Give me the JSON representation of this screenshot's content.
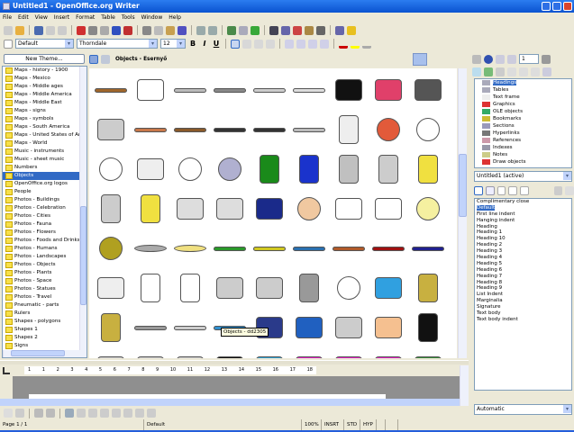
{
  "window": {
    "title": "Untitled1 - OpenOffice.org Writer"
  },
  "menu": [
    "File",
    "Edit",
    "View",
    "Insert",
    "Format",
    "Table",
    "Tools",
    "Window",
    "Help"
  ],
  "format_bar": {
    "style": "Default",
    "font": "Thorndale",
    "size": "12",
    "bold": "B",
    "italic": "I",
    "underline": "U"
  },
  "gallery": {
    "new_theme_label": "New Theme...",
    "themes": [
      "Maps - history - 1900",
      "Maps - Mexico",
      "Maps - Middle ages",
      "Maps - Middle America",
      "Maps - Middle East",
      "Maps - signs",
      "Maps - symbols",
      "Maps - South America",
      "Maps - United States of Amer",
      "Maps - World",
      "Music - instruments",
      "Music - sheet music",
      "Numbers",
      "Objects",
      "OpenOffice.org logos",
      "People",
      "Photos - Buildings",
      "Photos - Celebration",
      "Photos - Cities",
      "Photos - Fauna",
      "Photos - Flowers",
      "Photos - Foods and Drinks",
      "Photos - Humans",
      "Photos - Landscapes",
      "Photos - Objects",
      "Photos - Plants",
      "Photos - Space",
      "Photos - Statues",
      "Photos - Travel",
      "Pneumatic - parts",
      "Rulers",
      "Shapes - polygons",
      "Shapes 1",
      "Shapes 2",
      "Signs"
    ],
    "selected_theme": "Objects",
    "header_title": "Objects - Esernyő",
    "tooltip": "Objects - dd2305",
    "items": [
      {
        "icon": "guitar",
        "color": "#a0662b"
      },
      {
        "icon": "heart",
        "color": "#ffffff"
      },
      {
        "icon": "wrench",
        "color": "#bbbbbb"
      },
      {
        "icon": "key",
        "color": "#888888"
      },
      {
        "icon": "old-key",
        "color": "#cccccc"
      },
      {
        "icon": "grater",
        "color": "#dddddd"
      },
      {
        "icon": "hat",
        "color": "#111111"
      },
      {
        "icon": "cap",
        "color": "#e0406a"
      },
      {
        "icon": "videotape",
        "color": "#555555"
      },
      {
        "icon": "coffee-maker",
        "color": "#cccccc"
      },
      {
        "icon": "knife",
        "color": "#c8784a"
      },
      {
        "icon": "knife",
        "color": "#8a5a2a"
      },
      {
        "icon": "knife",
        "color": "#333333"
      },
      {
        "icon": "knife",
        "color": "#333333"
      },
      {
        "icon": "spoon",
        "color": "#bbbbbb"
      },
      {
        "icon": "bottle",
        "color": "#eeeeee"
      },
      {
        "icon": "button-red",
        "color": "#e25a3a"
      },
      {
        "icon": "button-white",
        "color": "#ffffff"
      },
      {
        "icon": "ball",
        "color": "#ffffff"
      },
      {
        "icon": "roll",
        "color": "#eeeeee"
      },
      {
        "icon": "bowl",
        "color": "#ffffff"
      },
      {
        "icon": "bowl",
        "color": "#b0b0d0"
      },
      {
        "icon": "boot-green",
        "color": "#1a8a1a"
      },
      {
        "icon": "boot-blue",
        "color": "#1a33cc"
      },
      {
        "icon": "boot-grey",
        "color": "#c0c0c0"
      },
      {
        "icon": "mailbox",
        "color": "#cccccc"
      },
      {
        "icon": "mailbox-yellow",
        "color": "#f0e040"
      },
      {
        "icon": "mailbox",
        "color": "#cccccc"
      },
      {
        "icon": "mailbox-yellow",
        "color": "#f0e040"
      },
      {
        "icon": "box-open",
        "color": "#dddddd"
      },
      {
        "icon": "box",
        "color": "#dddddd"
      },
      {
        "icon": "bench",
        "color": "#1a2a8a"
      },
      {
        "icon": "beach-ball",
        "color": "#f0c8a0"
      },
      {
        "icon": "bathtub",
        "color": "#ffffff"
      },
      {
        "icon": "bathtub",
        "color": "#ffffff"
      },
      {
        "icon": "ring",
        "color": "#f5f0a0"
      },
      {
        "icon": "ring-gem",
        "color": "#b0a020"
      },
      {
        "icon": "plate",
        "color": "#aaaaaa"
      },
      {
        "icon": "plate-gold",
        "color": "#f0e080"
      },
      {
        "icon": "pencil",
        "color": "#2a9a2a"
      },
      {
        "icon": "pencil",
        "color": "#d0c820"
      },
      {
        "icon": "pencil",
        "color": "#2a70b0"
      },
      {
        "icon": "pencil",
        "color": "#b05a2a"
      },
      {
        "icon": "pencil",
        "color": "#a01010"
      },
      {
        "icon": "pencil",
        "color": "#202090"
      },
      {
        "icon": "paper-clips",
        "color": "#eeeeee"
      },
      {
        "icon": "snowman",
        "color": "#ffffff"
      },
      {
        "icon": "snowman",
        "color": "#ffffff"
      },
      {
        "icon": "camera",
        "color": "#cccccc"
      },
      {
        "icon": "camera",
        "color": "#cccccc"
      },
      {
        "icon": "calculator",
        "color": "#999999"
      },
      {
        "icon": "light-bulb",
        "color": "#ffffff"
      },
      {
        "icon": "skirt",
        "color": "#30a0e0"
      },
      {
        "icon": "fork-garden",
        "color": "#c8b040"
      },
      {
        "icon": "fork-garden",
        "color": "#c8b040"
      },
      {
        "icon": "drill-bit",
        "color": "#999999"
      },
      {
        "icon": "fork",
        "color": "#cccccc"
      },
      {
        "icon": "fork",
        "color": "#3090d0"
      },
      {
        "icon": "book-open",
        "color": "#2a3a8a"
      },
      {
        "icon": "book",
        "color": "#2060c0"
      },
      {
        "icon": "doghouse",
        "color": "#cccccc"
      },
      {
        "icon": "nose",
        "color": "#f5c090"
      },
      {
        "icon": "hook",
        "color": "#111111"
      },
      {
        "icon": "item",
        "color": "#cccccc"
      },
      {
        "icon": "item",
        "color": "#cccccc"
      },
      {
        "icon": "item",
        "color": "#cccccc"
      },
      {
        "icon": "glasses",
        "color": "#111111"
      },
      {
        "icon": "window",
        "color": "#30a0d0"
      },
      {
        "icon": "folder",
        "color": "#e020c0"
      },
      {
        "icon": "folder",
        "color": "#e020c0"
      },
      {
        "icon": "folder",
        "color": "#e020c0"
      },
      {
        "icon": "item",
        "color": "#3a8a3a"
      }
    ]
  },
  "navigator": {
    "page": "1",
    "items": [
      "Headings",
      "Tables",
      "Text frame",
      "Graphics",
      "OLE objects",
      "Bookmarks",
      "Sections",
      "Hyperlinks",
      "References",
      "Indexes",
      "Notes",
      "Draw objects"
    ],
    "document": "Untitled1 (active)"
  },
  "styles": {
    "items": [
      "Complimentary close",
      "Default",
      "First line indent",
      "Hanging indent",
      "Heading",
      "Heading 1",
      "Heading 10",
      "Heading 2",
      "Heading 3",
      "Heading 4",
      "Heading 5",
      "Heading 6",
      "Heading 7",
      "Heading 8",
      "Heading 9",
      "List Indent",
      "Marginalia",
      "Signature",
      "Text body",
      "Text body indent"
    ],
    "selected": "Default",
    "filter": "Automatic"
  },
  "ruler": [
    "1",
    "1",
    "2",
    "3",
    "4",
    "5",
    "6",
    "7",
    "8",
    "9",
    "10",
    "11",
    "12",
    "13",
    "14",
    "15",
    "16",
    "17",
    "18"
  ],
  "status": {
    "page": "Page 1 / 1",
    "style": "Default",
    "zoom": "100%",
    "insert": "INSRT",
    "selection": "STD",
    "hyperlink": "HYP"
  }
}
